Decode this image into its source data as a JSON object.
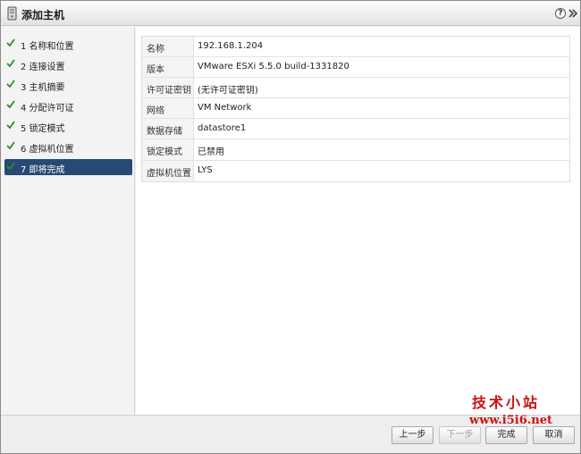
{
  "window": {
    "title": "添加主机",
    "help": "?",
    "icon": "host-icon",
    "expand_icon": "double-chevron-right-icon"
  },
  "steps": [
    {
      "label": "1 名称和位置",
      "done": true,
      "active": false
    },
    {
      "label": "2 连接设置",
      "done": true,
      "active": false
    },
    {
      "label": "3 主机摘要",
      "done": true,
      "active": false
    },
    {
      "label": "4 分配许可证",
      "done": true,
      "active": false
    },
    {
      "label": "5 锁定模式",
      "done": true,
      "active": false
    },
    {
      "label": "6 虚拟机位置",
      "done": true,
      "active": false
    },
    {
      "label": "7 即将完成",
      "done": true,
      "active": true
    }
  ],
  "summary": [
    {
      "key": "名称",
      "value": "192.168.1.204"
    },
    {
      "key": "版本",
      "value": "VMware ESXi 5.5.0 build-1331820"
    },
    {
      "key": "许可证密钥",
      "value": "(无许可证密钥)"
    },
    {
      "key": "网络",
      "value": "VM Network"
    },
    {
      "key": "数据存储",
      "value": "datastore1"
    },
    {
      "key": "锁定模式",
      "value": "已禁用"
    },
    {
      "key": "虚拟机位置",
      "value": "LYS"
    }
  ],
  "buttons": {
    "back": "上一步",
    "next": "下一步",
    "finish": "完成",
    "cancel": "取消"
  },
  "watermark": {
    "line1": "技术小站",
    "line2": "www.i5i6.net"
  },
  "colors": {
    "active_step_bg": "#264a73",
    "check_green": "#2e8b2e",
    "watermark_red": "#cc1111"
  }
}
